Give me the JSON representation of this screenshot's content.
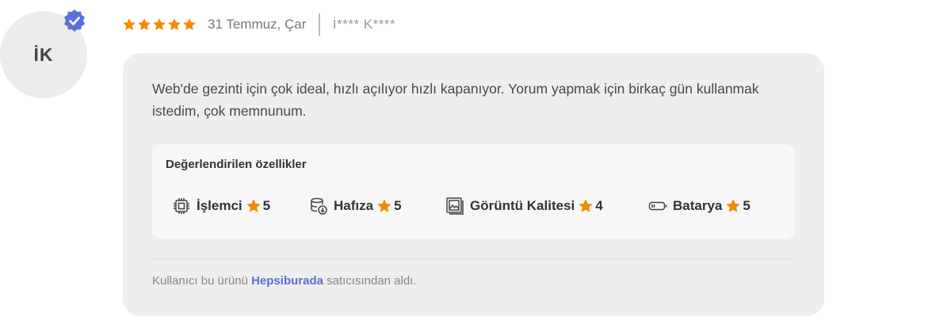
{
  "reviewer": {
    "initials": "İK",
    "masked_name": "İ**** K****",
    "verified": true
  },
  "review": {
    "rating": 5,
    "rating_max": 5,
    "date": "31 Temmuz, Çar",
    "text": "Web'de gezinti için çok ideal, hızlı açılıyor hızlı kapanıyor. Yorum yapmak için birkaç gün kullanmak istedim, çok memnunum."
  },
  "features": {
    "title": "Değerlendirilen özellikler",
    "items": [
      {
        "label": "İşlemci",
        "score": "5",
        "icon": "cpu-icon"
      },
      {
        "label": "Hafıza",
        "score": "5",
        "icon": "storage-icon"
      },
      {
        "label": "Görüntü Kalitesi",
        "score": "4",
        "icon": "image-quality-icon"
      },
      {
        "label": "Batarya",
        "score": "5",
        "icon": "battery-icon"
      }
    ]
  },
  "purchase": {
    "prefix": "Kullanıcı bu ürünü",
    "seller": "Hepsiburada",
    "suffix": "satıcısından aldı."
  },
  "colors": {
    "star": "#f28b00",
    "verified_badge": "#5b6fd8",
    "seller_link": "#5b6fd8",
    "card_background": "#eeeeee"
  }
}
